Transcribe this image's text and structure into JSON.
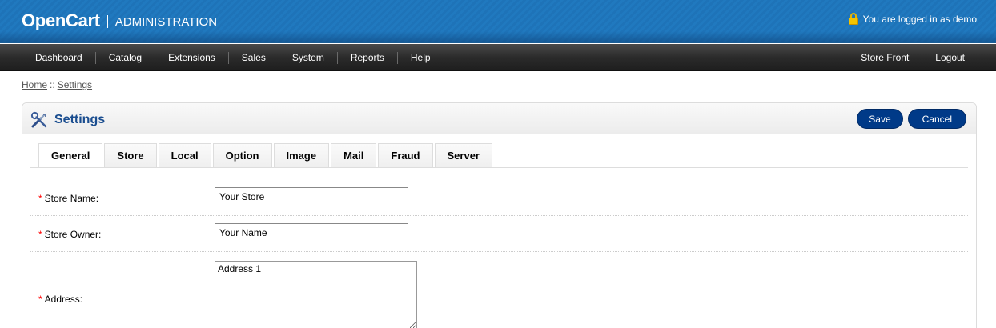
{
  "header": {
    "brand": "OpenCart",
    "subtitle": "ADMINISTRATION",
    "login_text": "You are logged in as demo",
    "icon": "lock-icon"
  },
  "menu": {
    "left": [
      "Dashboard",
      "Catalog",
      "Extensions",
      "Sales",
      "System",
      "Reports",
      "Help"
    ],
    "right": [
      "Store Front",
      "Logout"
    ]
  },
  "breadcrumb": {
    "home": "Home",
    "separator": "::",
    "current": "Settings"
  },
  "panel": {
    "title": "Settings",
    "icon": "settings-tools-icon",
    "save_label": "Save",
    "cancel_label": "Cancel"
  },
  "tabs": [
    "General",
    "Store",
    "Local",
    "Option",
    "Image",
    "Mail",
    "Fraud",
    "Server"
  ],
  "active_tab": "General",
  "form": {
    "required_mark": "*",
    "store_name": {
      "label": "Store Name:",
      "value": "Your Store"
    },
    "store_owner": {
      "label": "Store Owner:",
      "value": "Your Name"
    },
    "address": {
      "label": "Address:",
      "value": "Address 1"
    }
  },
  "colors": {
    "header_blue": "#1e73b8",
    "menu_dark": "#2b2b2b",
    "button_blue": "#003a88",
    "title_blue": "#1a4d8f",
    "required_red": "#ff0000"
  }
}
